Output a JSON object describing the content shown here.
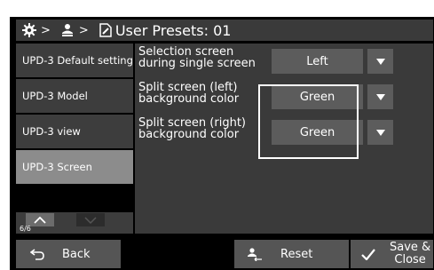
{
  "header": {
    "title": "User Presets: 01",
    "icons": [
      "gear-icon",
      "user-icon",
      "document-icon"
    ],
    "separator": ">"
  },
  "sidebar": {
    "items": [
      {
        "label": "UPD-3 Default setting",
        "selected": false
      },
      {
        "label": "UPD-3 Model",
        "selected": false
      },
      {
        "label": "UPD-3 view",
        "selected": false
      },
      {
        "label": "UPD-3 Screen",
        "selected": true
      }
    ],
    "page_indicator": "6/6"
  },
  "settings": {
    "rows": [
      {
        "label_line1": "Selection screen",
        "label_line2": "during single screen",
        "value": "Left"
      },
      {
        "label_line1": "Split screen (left)",
        "label_line2": "background color",
        "value": "Green"
      },
      {
        "label_line1": "Split screen (right)",
        "label_line2": "background color",
        "value": "Green"
      }
    ]
  },
  "footer": {
    "back_label": "Back",
    "reset_label": "Reset",
    "save_label_line1": "Save &",
    "save_label_line2": "Close"
  },
  "colors": {
    "panel": "#3a3a3a",
    "item": "#3d3d3d",
    "selected_item": "#8c8c8c",
    "button": "#5c5c5c",
    "highlight": "#ffffff"
  }
}
